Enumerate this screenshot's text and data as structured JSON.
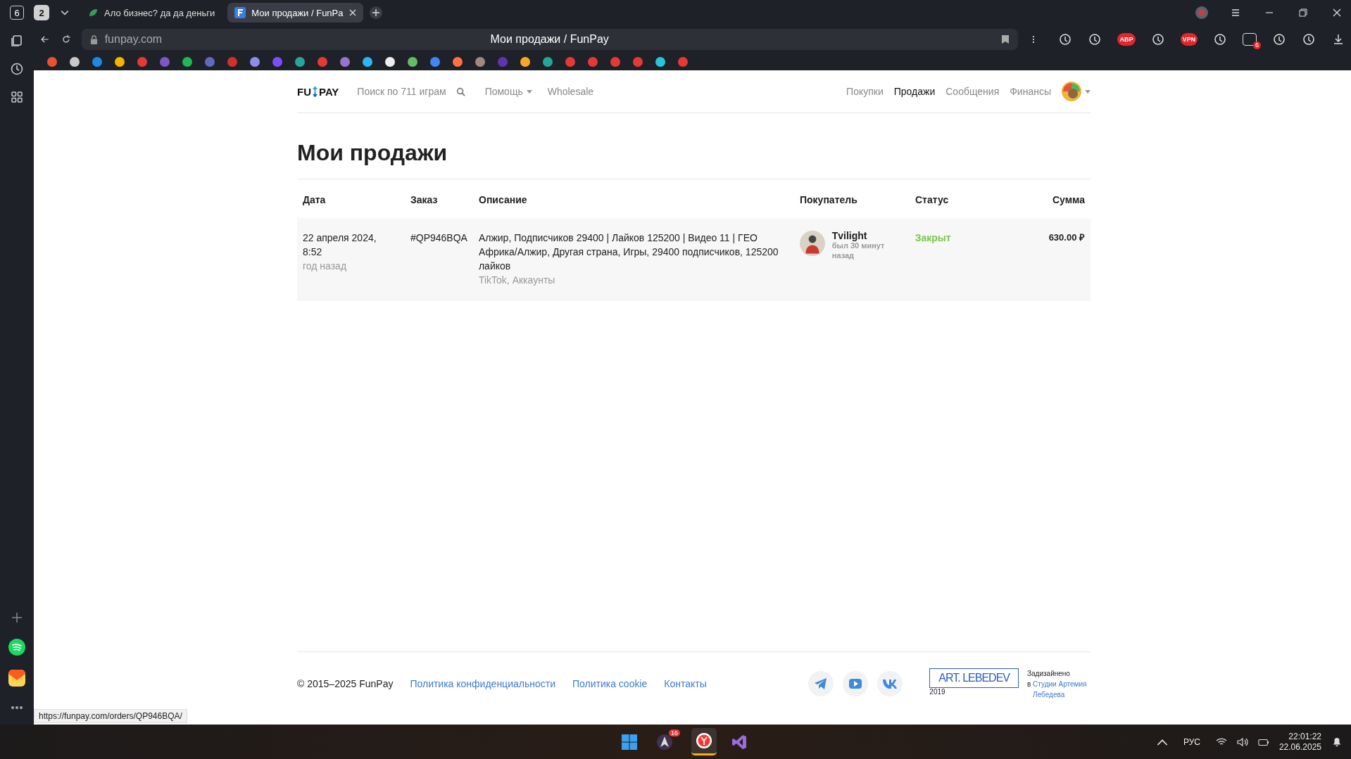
{
  "browser": {
    "tab_count": "6",
    "tab_group_count": "2",
    "tabs": [
      {
        "title": "Ало бизнес? да да деньги",
        "selected": false
      },
      {
        "title": "Мои продажи / FunPa",
        "selected": true
      }
    ],
    "address": "funpay.com",
    "page_title": "Мои продажи / FunPay",
    "extensions": [
      {
        "kind": "icon"
      },
      {
        "kind": "icon"
      },
      {
        "kind": "text",
        "label": "ABP"
      },
      {
        "kind": "icon"
      },
      {
        "kind": "text",
        "label": "VPN"
      },
      {
        "kind": "icon"
      },
      {
        "kind": "badge",
        "label": "6"
      },
      {
        "kind": "icon"
      },
      {
        "kind": "icon"
      }
    ]
  },
  "site": {
    "logo": {
      "left": "FU",
      "right": "PAY"
    },
    "search_placeholder": "Поиск по 711 играм",
    "help": "Помощь",
    "wholesale": "Wholesale",
    "nav": [
      {
        "label": "Покупки",
        "selected": false
      },
      {
        "label": "Продажи",
        "selected": true
      },
      {
        "label": "Сообщения",
        "selected": false
      },
      {
        "label": "Финансы",
        "selected": false
      }
    ]
  },
  "title": "Мои продажи",
  "table": {
    "columns": [
      "Дата",
      "Заказ",
      "Описание",
      "Покупатель",
      "Статус",
      "Сумма"
    ],
    "rows": [
      {
        "date": "22 апреля 2024, 8:52",
        "ago": "год назад",
        "order": "#QP946BQA",
        "description": "Алжир, Подписчиков 29400 | Лайков 125200 | Видео 11 | ГЕО Африка/Алжир, Другая страна, Игры, 29400 подписчиков, 125200 лайков",
        "category": "TikTok, Аккаунты",
        "buyer": "Tvilight",
        "seen": "был 30 минут назад",
        "status": "Закрыт",
        "sum": "630.00 ₽"
      }
    ]
  },
  "footer": {
    "copyright": "© 2015–2025 FunPay",
    "links": [
      "Политика конфиденциальности",
      "Политика cookie",
      "Контакты"
    ],
    "studio_logo": "ART. LEBEDEV",
    "studio_year": "2019",
    "designed": "Задизайнено",
    "designed_in": "в",
    "studio_link": "Студии Артемия Лебедева"
  },
  "status_url": "https://funpay.com/orders/QP946BQA/",
  "taskbar": {
    "badge": "16",
    "lang": "РУС",
    "time": "22:01:22",
    "date": "22.06.2025"
  }
}
